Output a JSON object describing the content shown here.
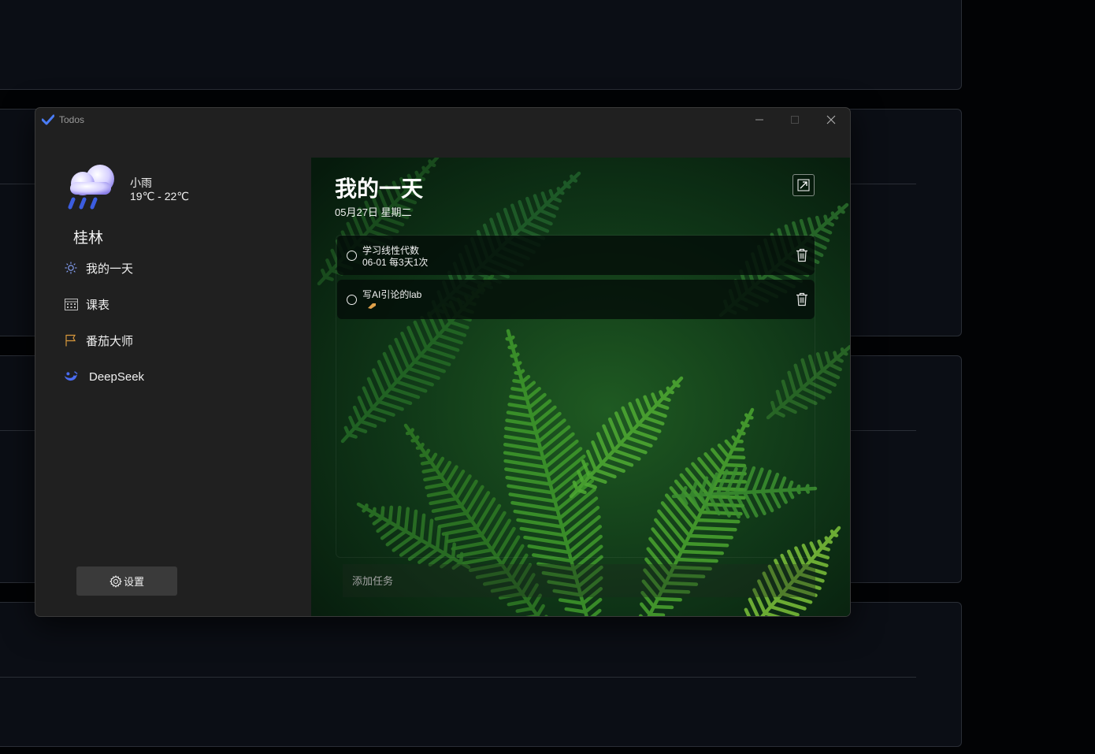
{
  "window": {
    "title": "Todos"
  },
  "weather": {
    "condition": "小雨",
    "temperature": "19℃ - 22℃",
    "city": "桂林"
  },
  "nav": [
    {
      "label": "我的一天",
      "icon": "sun-icon"
    },
    {
      "label": "课表",
      "icon": "calendar-icon"
    },
    {
      "label": "番茄大师",
      "icon": "flag-icon"
    },
    {
      "label": "DeepSeek",
      "icon": "deepseek-whale-icon"
    }
  ],
  "settings": {
    "label": "设置"
  },
  "main": {
    "title": "我的一天",
    "date": "05月27日 星期二",
    "tasks": [
      {
        "title": "学习线性代数",
        "subtitle": "06-01 每3天1次"
      },
      {
        "title": "写AI引论的lab",
        "subtitle": ""
      }
    ],
    "add_task_placeholder": "添加任务"
  },
  "colors": {
    "accent": "#4a7cf6",
    "sidebar_bg": "#202020",
    "page_bg": "#020305"
  }
}
